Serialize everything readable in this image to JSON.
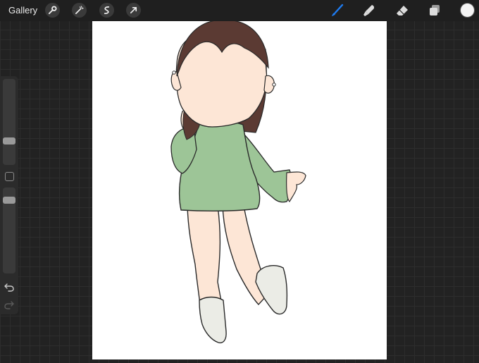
{
  "topbar": {
    "gallery_label": "Gallery",
    "left_tools": [
      "wrench-icon",
      "magic-wand-icon",
      "selection-icon",
      "transform-arrow-icon"
    ],
    "right_tools": [
      "brush-icon",
      "smudge-icon",
      "eraser-icon",
      "layers-icon"
    ],
    "active_tool": "brush-icon",
    "accent_color": "#1e7cf2",
    "current_color": "#f4f4f4"
  },
  "sidebar": {
    "brush_size_level": 0.33,
    "opacity_level": 0.95,
    "icons": [
      "modifier-square-icon",
      "undo-icon",
      "redo-icon"
    ]
  },
  "colors": {
    "hair": "#5b3a33",
    "skin": "#fde6d6",
    "shirt": "#9dc597",
    "socks": "#ebece6"
  }
}
